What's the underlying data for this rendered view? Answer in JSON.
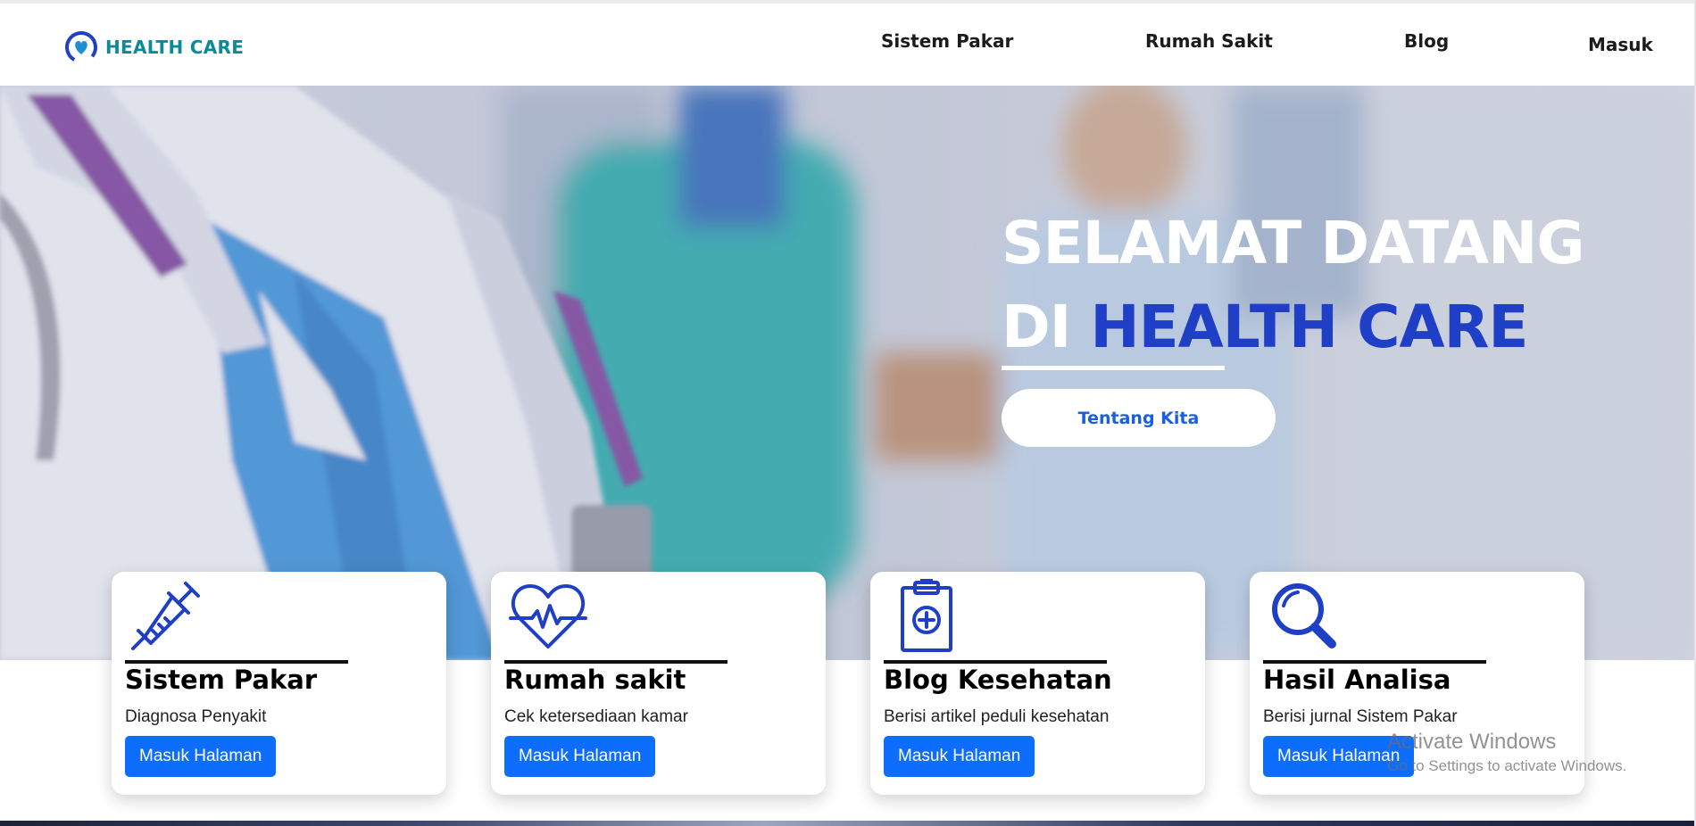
{
  "brand": {
    "name": "HEALTH CARE",
    "color": "#0b8a9a"
  },
  "nav": {
    "sistem_pakar": "Sistem Pakar",
    "rumah_sakit": "Rumah Sakit",
    "blog": "Blog",
    "masuk": "Masuk"
  },
  "hero": {
    "title_line1": "SELAMAT DATANG",
    "title_line2_prefix": "DI",
    "title_line2_accent": "HEALTH CARE",
    "accent_color": "#1f3fc6",
    "cta_label": "Tentang Kita"
  },
  "cards": [
    {
      "icon": "syringe-icon",
      "title": "Sistem Pakar",
      "desc": "Diagnosa Penyakit",
      "button": "Masuk Halaman"
    },
    {
      "icon": "heartbeat-icon",
      "title": "Rumah sakit",
      "desc": "Cek ketersediaan kamar",
      "button": "Masuk Halaman"
    },
    {
      "icon": "clipboard-plus-icon",
      "title": "Blog Kesehatan",
      "desc": "Berisi artikel peduli kesehatan",
      "button": "Masuk Halaman"
    },
    {
      "icon": "magnifier-icon",
      "title": "Hasil Analisa",
      "desc": "Berisi jurnal Sistem Pakar",
      "button": "Masuk Halaman"
    }
  ],
  "colors": {
    "primary_button": "#0d6efd",
    "icon_blue": "#1f3fc6"
  },
  "watermark": {
    "title": "Activate Windows",
    "subtitle": "Go to Settings to activate Windows."
  }
}
